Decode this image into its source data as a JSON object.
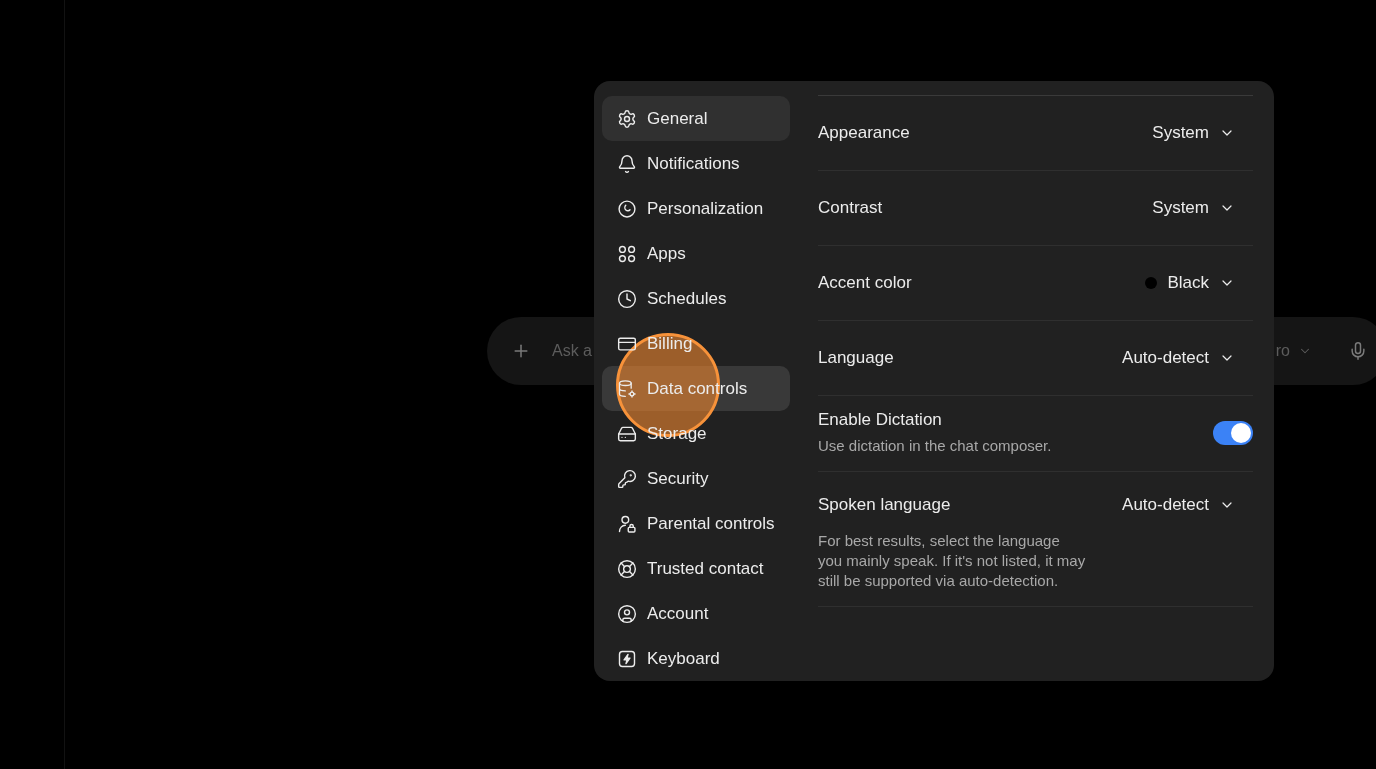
{
  "composer": {
    "placeholder": "Ask a",
    "model": "ro"
  },
  "settings_dialog": {
    "sidebar": {
      "items": [
        {
          "label": "General",
          "selected": true,
          "hovered": false
        },
        {
          "label": "Notifications",
          "selected": false,
          "hovered": false
        },
        {
          "label": "Personalization",
          "selected": false,
          "hovered": false
        },
        {
          "label": "Apps",
          "selected": false,
          "hovered": false
        },
        {
          "label": "Schedules",
          "selected": false,
          "hovered": false
        },
        {
          "label": "Billing",
          "selected": false,
          "hovered": false
        },
        {
          "label": "Data controls",
          "selected": false,
          "hovered": true
        },
        {
          "label": "Storage",
          "selected": false,
          "hovered": false
        },
        {
          "label": "Security",
          "selected": false,
          "hovered": false
        },
        {
          "label": "Parental controls",
          "selected": false,
          "hovered": false
        },
        {
          "label": "Trusted contact",
          "selected": false,
          "hovered": false
        },
        {
          "label": "Account",
          "selected": false,
          "hovered": false
        },
        {
          "label": "Keyboard",
          "selected": false,
          "hovered": false
        }
      ]
    },
    "rows": [
      {
        "kind": "select",
        "label": "Appearance",
        "value": "System"
      },
      {
        "kind": "select",
        "label": "Contrast",
        "value": "System"
      },
      {
        "kind": "select",
        "label": "Accent color",
        "value": "Black",
        "color": "#000000"
      },
      {
        "kind": "select",
        "label": "Language",
        "value": "Auto-detect"
      },
      {
        "kind": "toggle",
        "label": "Enable Dictation",
        "description": "Use dictation in the chat composer.",
        "on": true
      },
      {
        "kind": "select",
        "label": "Spoken language",
        "value": "Auto-detect",
        "description": "For best results, select the language you mainly speak. If it's not listed, it may still be supported via auto-detection."
      }
    ]
  }
}
